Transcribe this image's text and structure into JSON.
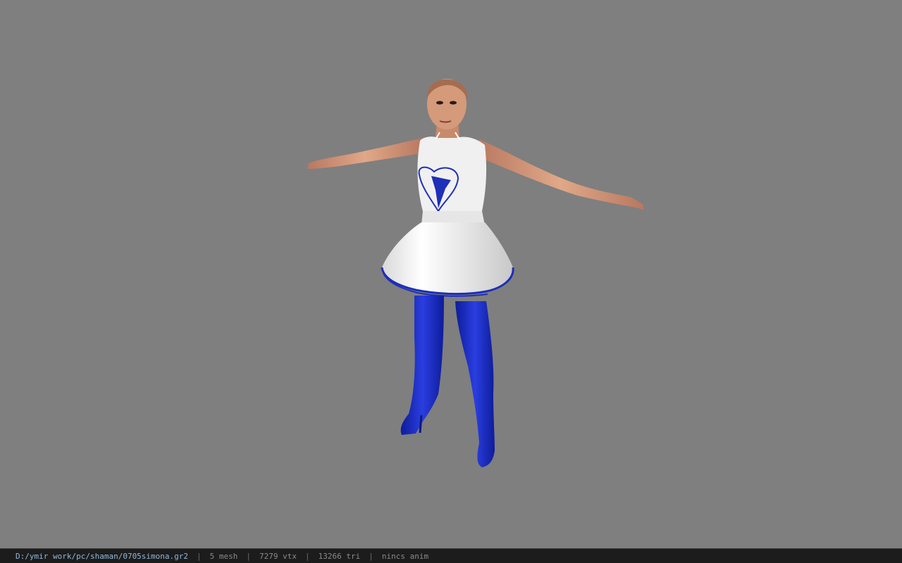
{
  "window": {
    "background_color": "#7f7f7f"
  },
  "viewport": {
    "model_name": "3D character model (T-pose)",
    "colors": {
      "skin": "#d89a78",
      "top": "#f2f2f2",
      "skirt": "#f4f4f4",
      "accent_blue": "#1e2fb8",
      "boots": "#1a2dd0"
    }
  },
  "status_bar": {
    "file_path": "D:/ymir work/pc/shaman/0705simona.gr2",
    "separator": "|",
    "mesh": "5 mesh",
    "vertices": "7279 vtx",
    "triangles": "13266 tri",
    "anim": "nincs anim"
  }
}
